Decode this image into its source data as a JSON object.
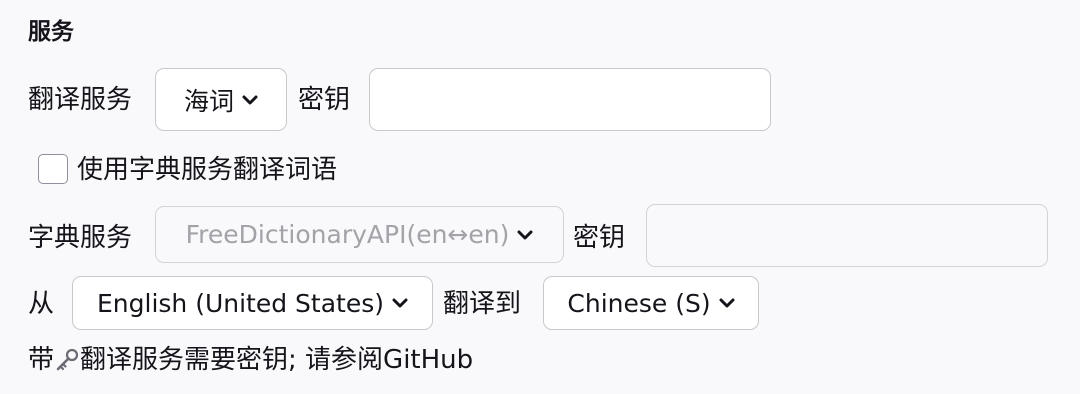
{
  "section": {
    "title": "服务"
  },
  "translation": {
    "service_label": "翻译服务",
    "service_value": "海词",
    "key_label": "密钥",
    "key_value": ""
  },
  "dict_checkbox": {
    "label": "使用字典服务翻译词语",
    "checked": false
  },
  "dictionary": {
    "service_label": "字典服务",
    "service_value": "FreeDictionaryAPI(en↔en)",
    "key_label": "密钥",
    "key_value": ""
  },
  "languages": {
    "from_label": "从",
    "from_value": "English (United States)",
    "to_label": "翻译到",
    "to_value": "Chinese (S)"
  },
  "note": {
    "prefix": "带",
    "icon": "key-icon",
    "text": "翻译服务需要密钥; 请参阅GitHub"
  }
}
